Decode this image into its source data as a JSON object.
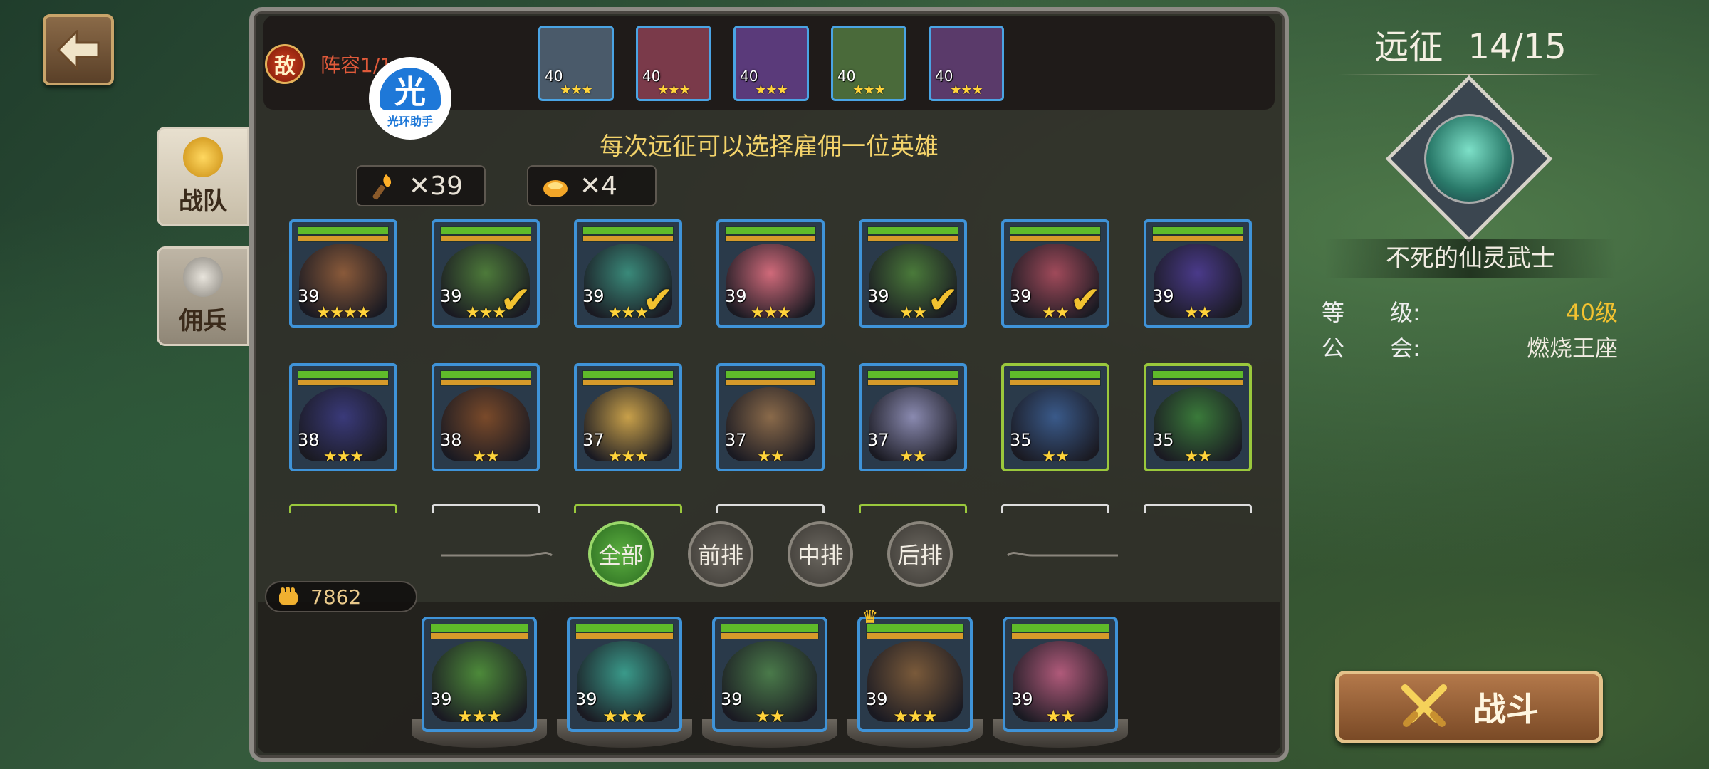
{
  "nav": {
    "back_icon": "back-arrow-icon"
  },
  "side_tabs": [
    {
      "label": "战队",
      "icon": "helmet-icon",
      "active": true
    },
    {
      "label": "佣兵",
      "icon": "knight-helmet-icon",
      "active": false
    }
  ],
  "enemy": {
    "badge": "敌",
    "lineup_label": "阵容1/1",
    "heroes": [
      {
        "level": "40",
        "stars": 3
      },
      {
        "level": "40",
        "stars": 3
      },
      {
        "level": "40",
        "stars": 3
      },
      {
        "level": "40",
        "stars": 3
      },
      {
        "level": "40",
        "stars": 3
      }
    ]
  },
  "helper_badge": {
    "glyph": "光",
    "text": "光环助手"
  },
  "notice": "每次远征可以选择雇佣一位英雄",
  "resources": [
    {
      "icon": "torch-icon",
      "value": "✕39"
    },
    {
      "icon": "potion-icon",
      "value": "✕4"
    }
  ],
  "roster": [
    {
      "level": "39",
      "stars": 4,
      "selected": false,
      "color": "#8a5a3a"
    },
    {
      "level": "39",
      "stars": 3,
      "selected": true,
      "color": "#4d7a3a"
    },
    {
      "level": "39",
      "stars": 3,
      "selected": true,
      "color": "#3a8a7a"
    },
    {
      "level": "39",
      "stars": 3,
      "selected": false,
      "color": "#d06a7a"
    },
    {
      "level": "39",
      "stars": 2,
      "selected": true,
      "color": "#4a7a3a"
    },
    {
      "level": "39",
      "stars": 2,
      "selected": true,
      "color": "#a04a5a"
    },
    {
      "level": "39",
      "stars": 2,
      "selected": false,
      "color": "#4a3a8a"
    },
    {
      "level": "38",
      "stars": 3,
      "selected": false,
      "color": "#3a3a7a"
    },
    {
      "level": "38",
      "stars": 2,
      "selected": false,
      "color": "#7a4a2a"
    },
    {
      "level": "37",
      "stars": 3,
      "selected": false,
      "color": "#c8a04a"
    },
    {
      "level": "37",
      "stars": 2,
      "selected": false,
      "color": "#8a6a4a"
    },
    {
      "level": "37",
      "stars": 2,
      "selected": false,
      "color": "#8a8ab0"
    },
    {
      "level": "35",
      "stars": 2,
      "selected": false,
      "color": "#3a5a8a",
      "green": true
    },
    {
      "level": "35",
      "stars": 2,
      "selected": false,
      "color": "#3a7a3a",
      "green": true
    }
  ],
  "filters": [
    {
      "label": "全部",
      "active": true
    },
    {
      "label": "前排",
      "active": false
    },
    {
      "label": "中排",
      "active": false
    },
    {
      "label": "后排",
      "active": false
    }
  ],
  "power": {
    "icon": "fist-icon",
    "value": "7862"
  },
  "team": [
    {
      "level": "39",
      "stars": 3,
      "color": "#4d8a3a"
    },
    {
      "level": "39",
      "stars": 3,
      "color": "#3a9a8a"
    },
    {
      "level": "39",
      "stars": 2,
      "color": "#4a7a4a"
    },
    {
      "level": "39",
      "stars": 3,
      "color": "#7a5a3a",
      "leader": true
    },
    {
      "level": "39",
      "stars": 2,
      "color": "#b05a7a"
    }
  ],
  "expedition": {
    "title": "远征",
    "progress": "14/15",
    "boss_name": "不死的仙灵武士",
    "level_key_a": "等",
    "level_key_b": "级:",
    "level_value": "40级",
    "guild_key_a": "公",
    "guild_key_b": "会:",
    "guild_value": "燃烧王座"
  },
  "fight_button": {
    "label": "战斗",
    "icon": "crossed-swords-icon"
  },
  "colors": {
    "accent_gold": "#f3d36a",
    "level_value": "#f2c230"
  }
}
